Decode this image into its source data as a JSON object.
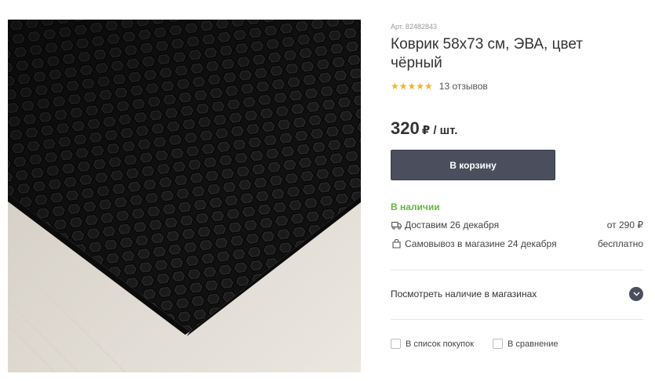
{
  "product": {
    "sku": "Арт. 82482843",
    "title": "Коврик 58х73 см, ЭВА, цвет чёрный",
    "rating_stars": "★★★★★",
    "reviews": "13 отзывов",
    "price": "320",
    "price_unit": "₽ / шт."
  },
  "cart_button": "В корзину",
  "availability": {
    "stock": "В наличии",
    "delivery_text": "Доставим 26 декабря",
    "delivery_cost": "от 290 ₽",
    "pickup_text": "Самовывоз в магазине 24 декабря",
    "pickup_cost": "бесплатно"
  },
  "stores_link": "Посмотреть наличие в магазинах",
  "actions": {
    "shopping_list": "В список покупок",
    "compare": "В сравнение"
  },
  "colors": {
    "accent_button": "#4a4e5d",
    "stock_green": "#62b63f",
    "star": "#f3b32a"
  }
}
